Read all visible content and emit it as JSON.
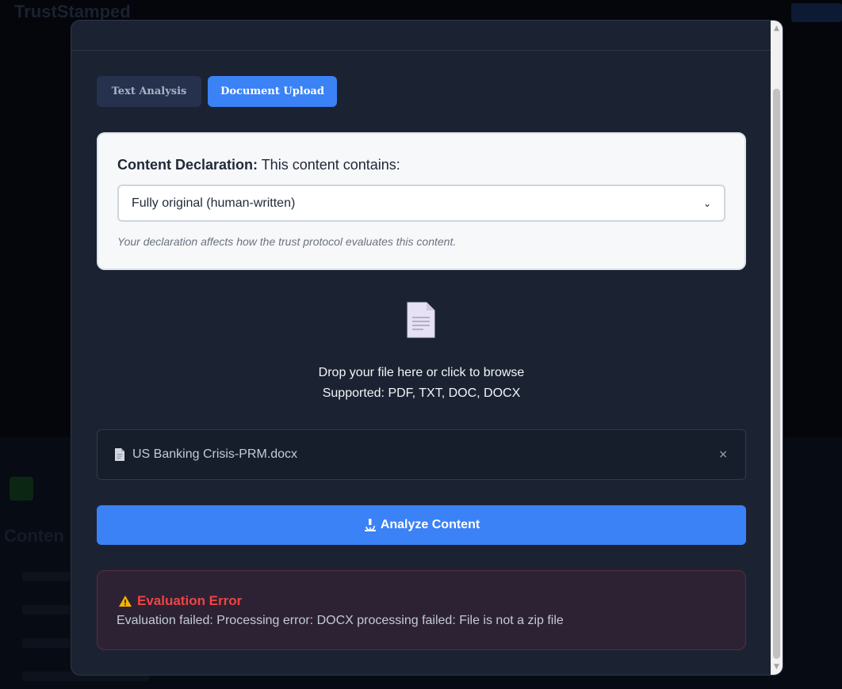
{
  "background": {
    "brand": "TrustStamped"
  },
  "tabs": [
    {
      "label": "Text Analysis",
      "active": false
    },
    {
      "label": "Document Upload",
      "active": true
    }
  ],
  "declaration": {
    "title_bold": "Content Declaration:",
    "title_rest": " This content contains:",
    "selected": "Fully original (human-written)",
    "note": "Your declaration affects how the trust protocol evaluates this content."
  },
  "dropzone": {
    "icon": "document-icon",
    "line1": "Drop your file here or click to browse",
    "line2": "Supported: PDF, TXT, DOC, DOCX"
  },
  "file": {
    "icon": "file-icon",
    "name": "US Banking Crisis-PRM.docx",
    "remove": "×"
  },
  "analyze": {
    "icon": "microscope-icon",
    "label": "Analyze Content"
  },
  "error": {
    "icon": "warning-icon",
    "title": "Evaluation Error",
    "message": "Evaluation failed: Processing error: DOCX processing failed: File is not a zip file"
  },
  "colors": {
    "accent": "#3b82f6",
    "modal_bg": "#1b2333",
    "error": "#ef4444"
  }
}
